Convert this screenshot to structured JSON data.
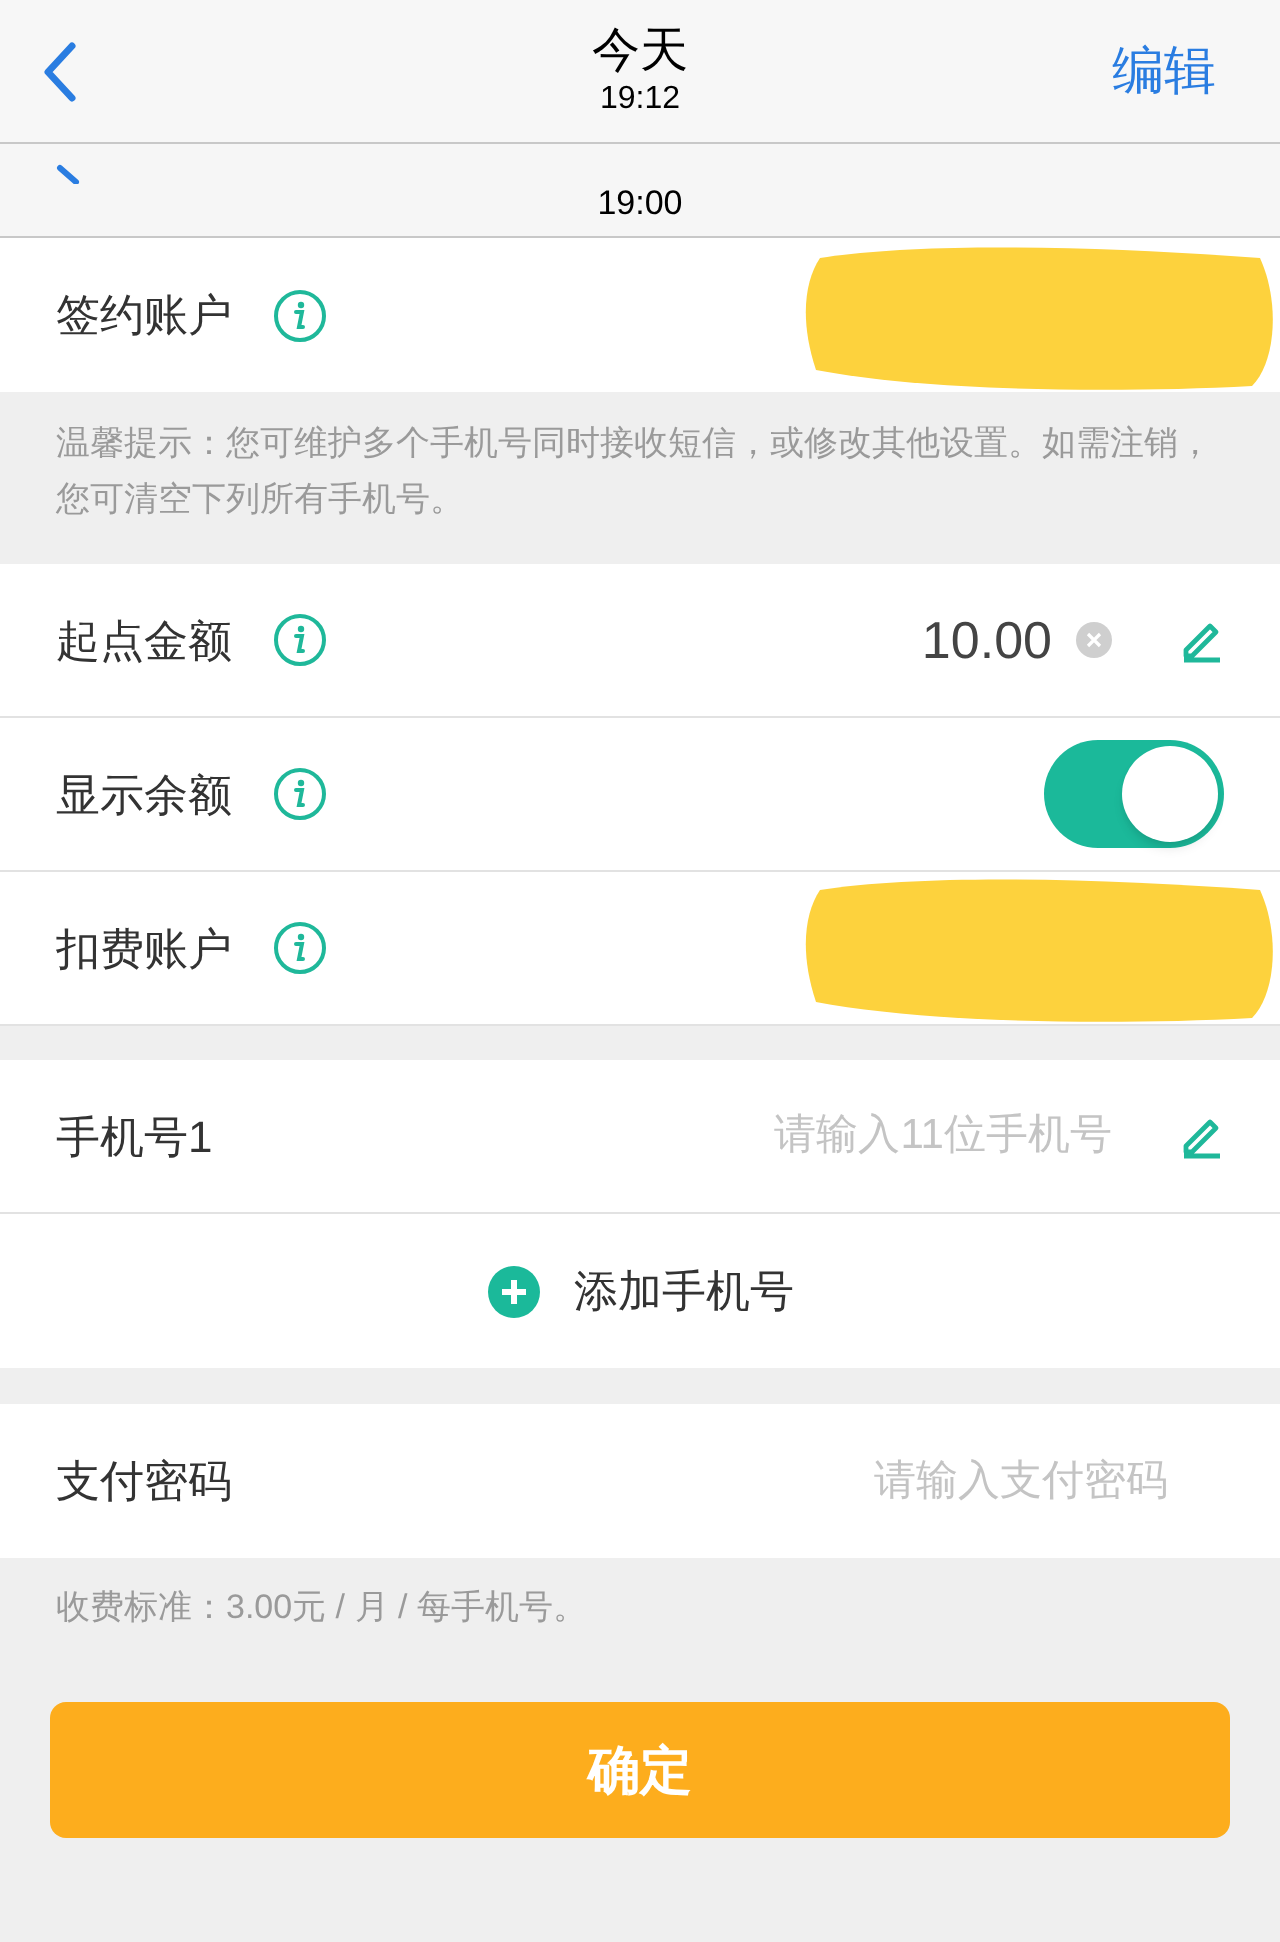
{
  "nav": {
    "title": "今天",
    "subtitle": "19:12",
    "action": "编辑"
  },
  "ghost_header": {
    "time": "19:00"
  },
  "contract_row": {
    "label": "签约账户",
    "redacted": true
  },
  "tip": "温馨提示：您可维护多个手机号同时接收短信，或修改其他设置。如需注销，您可清空下列所有手机号。",
  "settings": [
    {
      "kind": "amount",
      "label": "起点金额",
      "value": "10.00"
    },
    {
      "kind": "toggle",
      "label": "显示余额",
      "on": true
    },
    {
      "kind": "account",
      "label": "扣费账户",
      "redacted": true
    }
  ],
  "phone": {
    "label": "手机号1",
    "placeholder": "请输入11位手机号"
  },
  "add_phone": "添加手机号",
  "password": {
    "label": "支付密码",
    "placeholder": "请输入支付密码"
  },
  "fee_note": "收费标准：3.00元 / 月 / 每手机号。",
  "confirm": "确定"
}
